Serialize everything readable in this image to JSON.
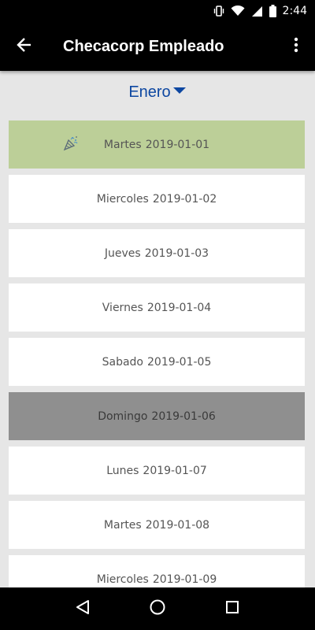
{
  "status_bar": {
    "time": "2:44",
    "icons": [
      "vibrate-icon",
      "wifi-icon",
      "signal-icon",
      "battery-icon"
    ]
  },
  "app_bar": {
    "title": "Checacorp Empleado",
    "back_icon": "arrow-back-icon",
    "menu_icon": "more-vert-icon"
  },
  "month_selector": {
    "label": "Enero",
    "icon": "dropdown-triangle-icon",
    "color": "#0d47a1"
  },
  "days": [
    {
      "name": "Martes",
      "date": "2019-01-01",
      "type": "holiday",
      "icon": "party-popper-icon"
    },
    {
      "name": "Miercoles",
      "date": "2019-01-02",
      "type": "normal"
    },
    {
      "name": "Jueves",
      "date": "2019-01-03",
      "type": "normal"
    },
    {
      "name": "Viernes",
      "date": "2019-01-04",
      "type": "normal"
    },
    {
      "name": "Sabado",
      "date": "2019-01-05",
      "type": "normal"
    },
    {
      "name": "Domingo",
      "date": "2019-01-06",
      "type": "sunday"
    },
    {
      "name": "Lunes",
      "date": "2019-01-07",
      "type": "normal"
    },
    {
      "name": "Martes",
      "date": "2019-01-08",
      "type": "normal"
    },
    {
      "name": "Miercoles",
      "date": "2019-01-09",
      "type": "normal"
    }
  ],
  "colors": {
    "holiday_bg": "#bccf98",
    "sunday_bg": "#8f8f8f",
    "normal_bg": "#ffffff",
    "page_bg": "#e6e6e6"
  },
  "nav_bar": {
    "icons": [
      "back-triangle-icon",
      "home-circle-icon",
      "recents-square-icon"
    ]
  }
}
